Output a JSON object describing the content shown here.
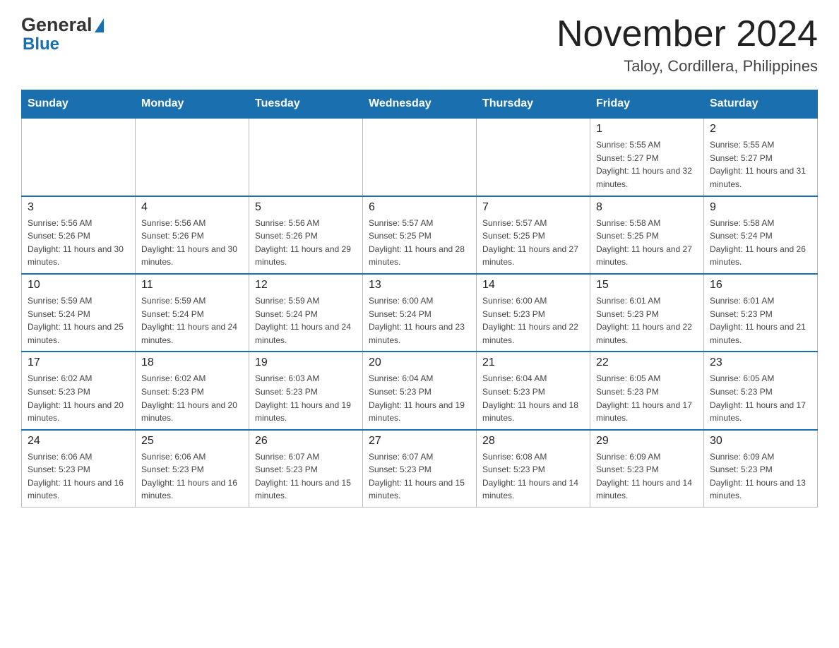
{
  "header": {
    "logo": {
      "general": "General",
      "blue": "Blue"
    },
    "title": "November 2024",
    "location": "Taloy, Cordillera, Philippines"
  },
  "calendar": {
    "days_of_week": [
      "Sunday",
      "Monday",
      "Tuesday",
      "Wednesday",
      "Thursday",
      "Friday",
      "Saturday"
    ],
    "weeks": [
      {
        "cells": [
          {
            "day": "",
            "empty": true
          },
          {
            "day": "",
            "empty": true
          },
          {
            "day": "",
            "empty": true
          },
          {
            "day": "",
            "empty": true
          },
          {
            "day": "",
            "empty": true
          },
          {
            "day": "1",
            "sunrise": "Sunrise: 5:55 AM",
            "sunset": "Sunset: 5:27 PM",
            "daylight": "Daylight: 11 hours and 32 minutes."
          },
          {
            "day": "2",
            "sunrise": "Sunrise: 5:55 AM",
            "sunset": "Sunset: 5:27 PM",
            "daylight": "Daylight: 11 hours and 31 minutes."
          }
        ]
      },
      {
        "cells": [
          {
            "day": "3",
            "sunrise": "Sunrise: 5:56 AM",
            "sunset": "Sunset: 5:26 PM",
            "daylight": "Daylight: 11 hours and 30 minutes."
          },
          {
            "day": "4",
            "sunrise": "Sunrise: 5:56 AM",
            "sunset": "Sunset: 5:26 PM",
            "daylight": "Daylight: 11 hours and 30 minutes."
          },
          {
            "day": "5",
            "sunrise": "Sunrise: 5:56 AM",
            "sunset": "Sunset: 5:26 PM",
            "daylight": "Daylight: 11 hours and 29 minutes."
          },
          {
            "day": "6",
            "sunrise": "Sunrise: 5:57 AM",
            "sunset": "Sunset: 5:25 PM",
            "daylight": "Daylight: 11 hours and 28 minutes."
          },
          {
            "day": "7",
            "sunrise": "Sunrise: 5:57 AM",
            "sunset": "Sunset: 5:25 PM",
            "daylight": "Daylight: 11 hours and 27 minutes."
          },
          {
            "day": "8",
            "sunrise": "Sunrise: 5:58 AM",
            "sunset": "Sunset: 5:25 PM",
            "daylight": "Daylight: 11 hours and 27 minutes."
          },
          {
            "day": "9",
            "sunrise": "Sunrise: 5:58 AM",
            "sunset": "Sunset: 5:24 PM",
            "daylight": "Daylight: 11 hours and 26 minutes."
          }
        ]
      },
      {
        "cells": [
          {
            "day": "10",
            "sunrise": "Sunrise: 5:59 AM",
            "sunset": "Sunset: 5:24 PM",
            "daylight": "Daylight: 11 hours and 25 minutes."
          },
          {
            "day": "11",
            "sunrise": "Sunrise: 5:59 AM",
            "sunset": "Sunset: 5:24 PM",
            "daylight": "Daylight: 11 hours and 24 minutes."
          },
          {
            "day": "12",
            "sunrise": "Sunrise: 5:59 AM",
            "sunset": "Sunset: 5:24 PM",
            "daylight": "Daylight: 11 hours and 24 minutes."
          },
          {
            "day": "13",
            "sunrise": "Sunrise: 6:00 AM",
            "sunset": "Sunset: 5:24 PM",
            "daylight": "Daylight: 11 hours and 23 minutes."
          },
          {
            "day": "14",
            "sunrise": "Sunrise: 6:00 AM",
            "sunset": "Sunset: 5:23 PM",
            "daylight": "Daylight: 11 hours and 22 minutes."
          },
          {
            "day": "15",
            "sunrise": "Sunrise: 6:01 AM",
            "sunset": "Sunset: 5:23 PM",
            "daylight": "Daylight: 11 hours and 22 minutes."
          },
          {
            "day": "16",
            "sunrise": "Sunrise: 6:01 AM",
            "sunset": "Sunset: 5:23 PM",
            "daylight": "Daylight: 11 hours and 21 minutes."
          }
        ]
      },
      {
        "cells": [
          {
            "day": "17",
            "sunrise": "Sunrise: 6:02 AM",
            "sunset": "Sunset: 5:23 PM",
            "daylight": "Daylight: 11 hours and 20 minutes."
          },
          {
            "day": "18",
            "sunrise": "Sunrise: 6:02 AM",
            "sunset": "Sunset: 5:23 PM",
            "daylight": "Daylight: 11 hours and 20 minutes."
          },
          {
            "day": "19",
            "sunrise": "Sunrise: 6:03 AM",
            "sunset": "Sunset: 5:23 PM",
            "daylight": "Daylight: 11 hours and 19 minutes."
          },
          {
            "day": "20",
            "sunrise": "Sunrise: 6:04 AM",
            "sunset": "Sunset: 5:23 PM",
            "daylight": "Daylight: 11 hours and 19 minutes."
          },
          {
            "day": "21",
            "sunrise": "Sunrise: 6:04 AM",
            "sunset": "Sunset: 5:23 PM",
            "daylight": "Daylight: 11 hours and 18 minutes."
          },
          {
            "day": "22",
            "sunrise": "Sunrise: 6:05 AM",
            "sunset": "Sunset: 5:23 PM",
            "daylight": "Daylight: 11 hours and 17 minutes."
          },
          {
            "day": "23",
            "sunrise": "Sunrise: 6:05 AM",
            "sunset": "Sunset: 5:23 PM",
            "daylight": "Daylight: 11 hours and 17 minutes."
          }
        ]
      },
      {
        "cells": [
          {
            "day": "24",
            "sunrise": "Sunrise: 6:06 AM",
            "sunset": "Sunset: 5:23 PM",
            "daylight": "Daylight: 11 hours and 16 minutes."
          },
          {
            "day": "25",
            "sunrise": "Sunrise: 6:06 AM",
            "sunset": "Sunset: 5:23 PM",
            "daylight": "Daylight: 11 hours and 16 minutes."
          },
          {
            "day": "26",
            "sunrise": "Sunrise: 6:07 AM",
            "sunset": "Sunset: 5:23 PM",
            "daylight": "Daylight: 11 hours and 15 minutes."
          },
          {
            "day": "27",
            "sunrise": "Sunrise: 6:07 AM",
            "sunset": "Sunset: 5:23 PM",
            "daylight": "Daylight: 11 hours and 15 minutes."
          },
          {
            "day": "28",
            "sunrise": "Sunrise: 6:08 AM",
            "sunset": "Sunset: 5:23 PM",
            "daylight": "Daylight: 11 hours and 14 minutes."
          },
          {
            "day": "29",
            "sunrise": "Sunrise: 6:09 AM",
            "sunset": "Sunset: 5:23 PM",
            "daylight": "Daylight: 11 hours and 14 minutes."
          },
          {
            "day": "30",
            "sunrise": "Sunrise: 6:09 AM",
            "sunset": "Sunset: 5:23 PM",
            "daylight": "Daylight: 11 hours and 13 minutes."
          }
        ]
      }
    ]
  }
}
